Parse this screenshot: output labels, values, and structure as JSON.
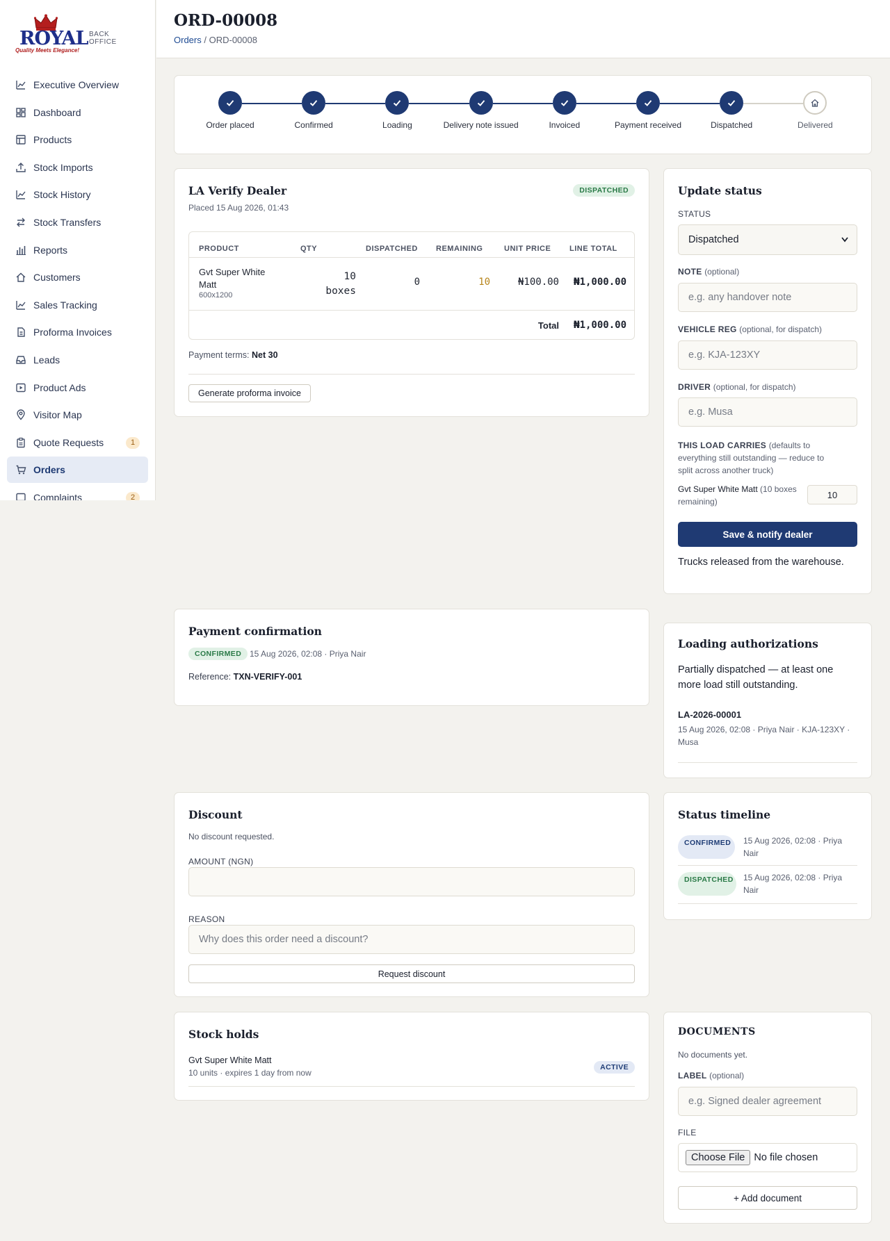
{
  "brand": {
    "logo_word": "ROYAL",
    "tagline": "Quality Meets Elegance!",
    "section": "BACK OFFICE"
  },
  "sidebar": {
    "items": [
      {
        "label": "Executive Overview",
        "icon": "line-chart-icon"
      },
      {
        "label": "Dashboard",
        "icon": "dashboard-icon"
      },
      {
        "label": "Products",
        "icon": "table-icon"
      },
      {
        "label": "Stock Imports",
        "icon": "upload-icon"
      },
      {
        "label": "Stock History",
        "icon": "line-chart-icon"
      },
      {
        "label": "Stock Transfers",
        "icon": "transfer-icon"
      },
      {
        "label": "Reports",
        "icon": "bar-chart-icon"
      },
      {
        "label": "Customers",
        "icon": "home-icon"
      },
      {
        "label": "Sales Tracking",
        "icon": "line-chart-icon"
      },
      {
        "label": "Proforma Invoices",
        "icon": "document-icon"
      },
      {
        "label": "Leads",
        "icon": "inbox-icon"
      },
      {
        "label": "Product Ads",
        "icon": "play-icon"
      },
      {
        "label": "Visitor Map",
        "icon": "map-pin-icon"
      },
      {
        "label": "Quote Requests",
        "icon": "clipboard-icon",
        "badge": "1"
      },
      {
        "label": "Orders",
        "icon": "cart-icon",
        "active": true
      },
      {
        "label": "Complaints",
        "icon": "message-icon",
        "badge": "2"
      }
    ]
  },
  "header": {
    "title": "ORD-00008",
    "breadcrumb_link": "Orders",
    "breadcrumb_sep": "/",
    "breadcrumb_current": "ORD-00008"
  },
  "stepper": {
    "steps": [
      {
        "label": "Order placed",
        "done": true
      },
      {
        "label": "Confirmed",
        "done": true
      },
      {
        "label": "Loading",
        "done": true
      },
      {
        "label": "Delivery note issued",
        "done": true
      },
      {
        "label": "Invoiced",
        "done": true
      },
      {
        "label": "Payment received",
        "done": true
      },
      {
        "label": "Dispatched",
        "done": true
      },
      {
        "label": "Delivered",
        "done": false
      }
    ]
  },
  "order": {
    "dealer": "LA Verify Dealer",
    "placed": "Placed 15 Aug 2026, 01:43",
    "status": "DISPATCHED",
    "columns": [
      "PRODUCT",
      "QTY",
      "DISPATCHED",
      "REMAINING",
      "UNIT PRICE",
      "LINE TOTAL"
    ],
    "row": {
      "product_line1": "Gvt Super White",
      "product_line2": "Matt",
      "size": "600x1200",
      "qty_line1": "10",
      "qty_line2": "boxes",
      "dispatched": "0",
      "remaining": "10",
      "unit_price": "₦100.00",
      "line_total": "₦1,000.00"
    },
    "total_label": "Total",
    "total_value": "₦1,000.00",
    "payment_terms_label": "Payment terms:",
    "payment_terms_value": "Net 30",
    "proforma_button": "Generate proforma invoice"
  },
  "update_status": {
    "title": "Update status",
    "status_label": "STATUS",
    "status_value": "Dispatched",
    "note_label": "NOTE",
    "note_hint": "(optional)",
    "note_placeholder": "e.g. any handover note",
    "vehicle_label": "VEHICLE REG",
    "vehicle_hint": "(optional, for dispatch)",
    "vehicle_placeholder": "e.g. KJA-123XY",
    "driver_label": "DRIVER",
    "driver_hint": "(optional, for dispatch)",
    "driver_placeholder": "e.g. Musa",
    "load_label": "THIS LOAD CARRIES",
    "load_hint_1": "(defaults to",
    "load_hint_2": "everything still outstanding — reduce to",
    "load_hint_3": "split across another truck)",
    "load_item_name": "Gvt Super White Matt",
    "load_item_hint_1": "(10 boxes",
    "load_item_hint_2": "remaining)",
    "load_item_qty": "10",
    "save_button": "Save & notify dealer",
    "status_description": "Trucks released from the warehouse."
  },
  "payment": {
    "title": "Payment confirmation",
    "status": "CONFIRMED",
    "meta": "15 Aug 2026, 02:08 · Priya Nair",
    "reference_label": "Reference:",
    "reference_value": "TXN-VERIFY-001"
  },
  "loading": {
    "title": "Loading authorizations",
    "description_1": "Partially dispatched — at least one",
    "description_2": "more load still outstanding.",
    "auth_id": "LA-2026-00001",
    "auth_meta_1": "15 Aug 2026, 02:08 · Priya Nair · KJA-123XY ·",
    "auth_meta_2": "Musa"
  },
  "discount": {
    "title": "Discount",
    "note": "No discount requested.",
    "amount_label": "AMOUNT (NGN)",
    "amount_value": "",
    "reason_label": "REASON",
    "reason_placeholder": "Why does this order need a discount?",
    "button": "Request discount"
  },
  "timeline": {
    "title": "Status timeline",
    "events": [
      {
        "status": "CONFIRMED",
        "meta_1": "15 Aug 2026, 02:08 · Priya",
        "meta_2": "Nair"
      },
      {
        "status": "DISPATCHED",
        "meta_1": "15 Aug 2026, 02:08 · Priya",
        "meta_2": "Nair"
      }
    ]
  },
  "holds": {
    "title": "Stock holds",
    "item_name": "Gvt Super White Matt",
    "item_meta": "10 units · expires 1 day from now",
    "item_status": "ACTIVE"
  },
  "documents": {
    "title": "DOCUMENTS",
    "note": "No documents yet.",
    "label_label": "LABEL",
    "label_hint": "(optional)",
    "label_placeholder": "e.g. Signed dealer agreement",
    "file_label": "FILE",
    "file_button": "Choose File",
    "file_status": "No file chosen",
    "add_button": "+ Add document"
  },
  "colors": {
    "primary": "#1f3a73",
    "accent_green": "#2a7a47",
    "remaining": "#b7851c"
  }
}
